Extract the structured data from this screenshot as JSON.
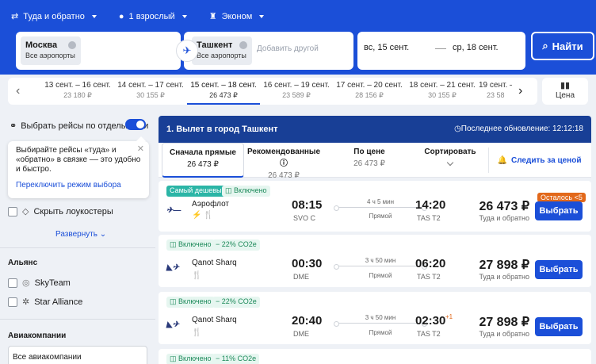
{
  "search": {
    "trip_type": "Туда и обратно",
    "passengers": "1 взрослый",
    "cabin": "Эконом",
    "from_city": "Москва",
    "from_sub": "Все аэропорты",
    "to_city": "Ташкент",
    "to_sub": "Все аэропорты",
    "add_other": "Добавить другой",
    "date_out": "вс, 15 сент.",
    "date_back": "ср, 18 сент.",
    "find_label": "Найти"
  },
  "dates": [
    {
      "range": "13 сент. – 16 сент.",
      "price": "23 180 ₽"
    },
    {
      "range": "14 сент. – 17 сент.",
      "price": "30 155 ₽"
    },
    {
      "range": "15 сент. – 18 сент.",
      "price": "26 473 ₽"
    },
    {
      "range": "16 сент. – 19 сент.",
      "price": "23 589 ₽"
    },
    {
      "range": "17 сент. – 20 сент.",
      "price": "28 156 ₽"
    },
    {
      "range": "18 сент. – 21 сент.",
      "price": "30 155 ₽"
    },
    {
      "range": "19 сент. – 2",
      "price": "23 58"
    }
  ],
  "price_chart_label": "Цена",
  "sidebar": {
    "separate_label": "Выбрать рейсы по отдельности",
    "tip_text": "Выбирайте рейсы «туда» и «обратно» в связке –– это удобно и быстро.",
    "tip_link": "Переключить режим выбора",
    "hide_lowcost": "Скрыть лоукостеры",
    "expand": "Развернуть",
    "alliance_title": "Альянс",
    "alliances": [
      "SkyTeam",
      "Star Alliance"
    ],
    "airlines_title": "Авиакомпании",
    "airlines_all": "Все авиакомпании"
  },
  "results": {
    "header_title": "1. Вылет в город Ташкент",
    "updated": "Последнее обновление: 12:12:18",
    "sort_tabs": [
      {
        "label": "Сначала прямые",
        "value": "26 473 ₽"
      },
      {
        "label": "Рекомендованные",
        "value": "26 473 ₽"
      },
      {
        "label": "По цене",
        "value": "26 473 ₽"
      },
      {
        "label": "Сортировать",
        "value": ""
      }
    ],
    "track_label": "Следить за ценой",
    "flights": [
      {
        "tags": [
          "Самый дешевый",
          "Включено"
        ],
        "airline": "Аэрофлот",
        "dep": "08:15",
        "dep_ap": "SVO C",
        "duration": "4 ч 5 мин",
        "stops": "Прямой",
        "arr": "14:20",
        "arr_ap": "TAS T2",
        "plus": "",
        "price": "26 473 ₽",
        "trip": "Туда и обратно",
        "badge": "Осталось <5",
        "select": "Выбрать"
      },
      {
        "tags": [
          "Включено",
          "− 22% CO2e"
        ],
        "airline": "Qanot Sharq",
        "dep": "00:30",
        "dep_ap": "DME",
        "duration": "3 ч 50 мин",
        "stops": "Прямой",
        "arr": "06:20",
        "arr_ap": "TAS T2",
        "plus": "",
        "price": "27 898 ₽",
        "trip": "Туда и обратно",
        "badge": "",
        "select": "Выбрать"
      },
      {
        "tags": [
          "Включено",
          "− 22% CO2e"
        ],
        "airline": "Qanot Sharq",
        "dep": "20:40",
        "dep_ap": "DME",
        "duration": "3 ч 50 мин",
        "stops": "Прямой",
        "arr": "02:30",
        "arr_ap": "TAS T2",
        "plus": "+1",
        "price": "27 898 ₽",
        "trip": "Туда и обратно",
        "badge": "",
        "select": "Выбрать"
      },
      {
        "tags": [
          "Включено",
          "− 11% CO2e"
        ]
      }
    ]
  },
  "colors": {
    "accent": "#1b4fd8",
    "header": "#183f96",
    "orange": "#e2681a",
    "teal": "#2bb5a6"
  }
}
